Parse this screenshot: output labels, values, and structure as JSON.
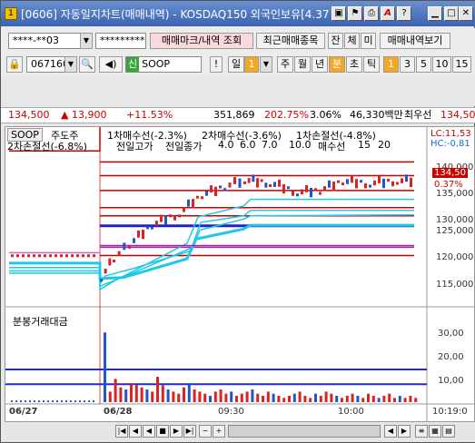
{
  "window": {
    "title": "[0606] 자동일지차트(매매내역) - KOSDAQ150 외국인보유[4.37",
    "icon": "1",
    "buttons": [
      "link-icon",
      "flag-icon",
      "print-icon",
      "a-icon",
      "help-icon",
      "minimize-icon",
      "maximize-icon",
      "close-icon"
    ]
  },
  "row1": {
    "account": "****-**03",
    "password": "*********",
    "btn_mark": "매매마크/내역 조회",
    "btn_recent": "최근매매종목",
    "btn_jan": "잔",
    "btn_che": "체",
    "btn_mi": "미",
    "btn_history": "매매내역보기"
  },
  "row2": {
    "code": "067160",
    "badge": "신",
    "name": "SOOP",
    "btn_excl": "!",
    "period_label": "일",
    "period_num": "1",
    "periods": [
      "주",
      "월",
      "년",
      "분",
      "초",
      "틱"
    ],
    "intervals": [
      "1",
      "3",
      "5",
      "10",
      "15"
    ]
  },
  "info": {
    "price": "134,500",
    "change": "▲ 13,900",
    "pct": "+11.53%",
    "volume": "351,869",
    "vol_pct": "202.75%",
    "ratio": "3.06%",
    "amount": "46,330백만",
    "low_label": "최우선",
    "low_price": "134,500"
  },
  "chart": {
    "name_tag": "SOOP",
    "legend": [
      {
        "text": "주도주",
        "color": "#0a8a3a"
      },
      {
        "text": "1차매수선(-2.3%)",
        "color": "#1a6ad8"
      },
      {
        "text": "2차매수선(-3.6%)",
        "color": "#1a6ad8"
      },
      {
        "text": "1차손절선(-4.8%)",
        "color": "#1a6ad8"
      },
      {
        "text": "2차손절선(-6.8%)",
        "color": "#1a6ad8"
      },
      {
        "text": "전일고가",
        "color": "#cc2222"
      },
      {
        "text": "전일종가",
        "color": "#aa22aa"
      },
      {
        "text": "4.0",
        "color": "#aa22aa"
      },
      {
        "text": "6.0",
        "color": "#aa22aa"
      },
      {
        "text": "7.0",
        "color": "#aa22aa"
      },
      {
        "text": "10.0",
        "color": "#aa22aa"
      },
      {
        "text": "매수선",
        "color": "#aa22aa"
      },
      {
        "text": "15",
        "color": "#aa22aa"
      },
      {
        "text": "20",
        "color": "#aa22aa"
      }
    ],
    "lc": "LC:11,53",
    "hc": "HC:-0,81",
    "y_labels": [
      "140,000",
      "135,000",
      "130,000",
      "125,000",
      "120,000",
      "115,000"
    ],
    "price_tag": "134,50",
    "price_pct": "0.37%",
    "vol_title": "분봉거래대금",
    "vol_labels": [
      "30,00",
      "20,00",
      "10,00"
    ],
    "x_labels": [
      "06/27",
      "06/28",
      "09:30",
      "10:00",
      "10:19:0"
    ]
  },
  "chart_data": {
    "type": "candlestick",
    "price_ylim": [
      112000,
      144000
    ],
    "levels": [
      {
        "value": 145300,
        "color": "#cc0000"
      },
      {
        "value": 138000,
        "color": "#cc0000"
      },
      {
        "value": 135500,
        "color": "#cc0000"
      },
      {
        "value": 132800,
        "color": "#cc0000"
      },
      {
        "value": 129700,
        "color": "#cc0000"
      },
      {
        "value": 128200,
        "color": "#cc0000"
      },
      {
        "value": 126400,
        "color": "#2222cc"
      },
      {
        "value": 122500,
        "color": "#aa22aa"
      },
      {
        "value": 121000,
        "color": "#cc0000"
      }
    ],
    "volume_ylim": [
      0,
      40
    ],
    "volume_lines": [
      8.5,
      15.5
    ],
    "candles": [
      134500
    ],
    "volume_bars": [
      33,
      5,
      11,
      7,
      6,
      9,
      8,
      7,
      6,
      5,
      12,
      8,
      6,
      5,
      4,
      7,
      9,
      6,
      5,
      4,
      3,
      5,
      6,
      4,
      5,
      3,
      4,
      5,
      6,
      4,
      3,
      5,
      4,
      3,
      2,
      3,
      4,
      5,
      3,
      2,
      4,
      3,
      5,
      4,
      3,
      2,
      3,
      4,
      3,
      2,
      4,
      3,
      2,
      3,
      4,
      2,
      3,
      2,
      3,
      2
    ]
  },
  "nav": {
    "buttons": [
      "first-icon",
      "prev-icon",
      "stop-icon",
      "next-icon",
      "last-icon",
      "zoom-out-icon",
      "zoom-in-icon",
      "list-icon",
      "grid-icon"
    ]
  }
}
